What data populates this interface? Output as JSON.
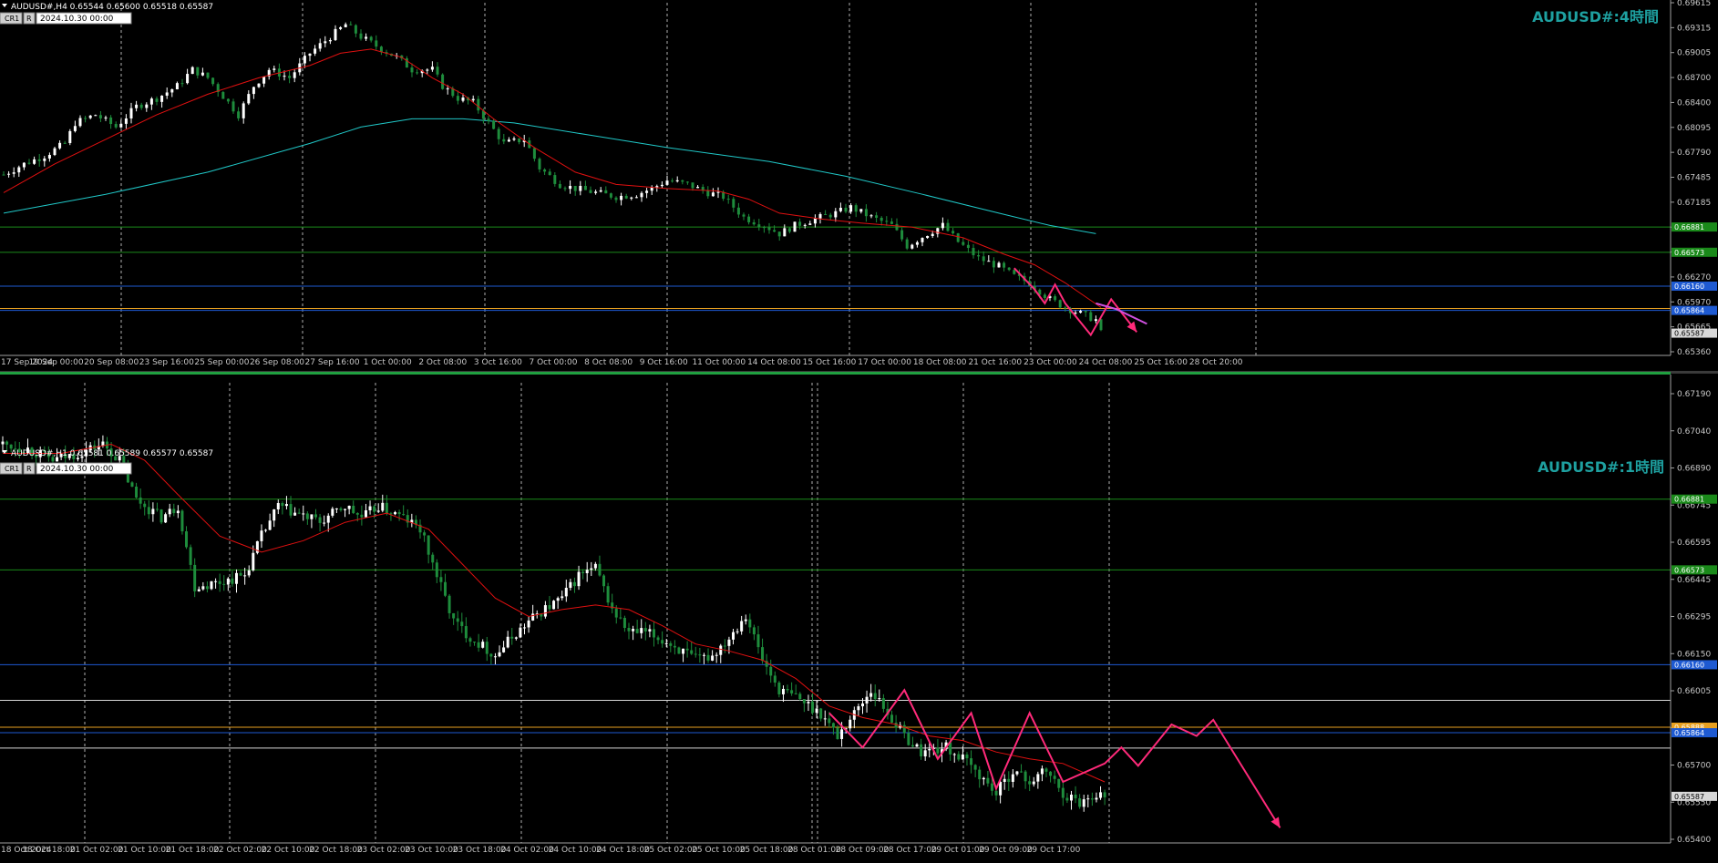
{
  "colors": {
    "background": "#000000",
    "bull_candle": "#ffffff",
    "bear_candle": "#1e8c3c",
    "ma_short": "#e01010",
    "ma_long": "#20c8c8",
    "level_green": "#1a8a1a",
    "level_blue": "#1e5ad2",
    "level_orange": "#e8a020",
    "level_white": "#d8d8d8",
    "projection_pink": "#ff2a7a",
    "projection_violet": "#d050e0",
    "title": "#1ea0a0"
  },
  "top_pane": {
    "symbol_info": "AUDUSD#,H4  0.65544 0.65600 0.65518 0.65587",
    "btn_cr1": "CR1",
    "btn_r": "R",
    "date_box": "2024.10.30 00:00",
    "title": "AUDUSD#:4時間",
    "price_badges": [
      {
        "text": "0.66881",
        "color": "#1a8a1a",
        "price": 0.66881
      },
      {
        "text": "0.66573",
        "color": "#1a8a1a",
        "price": 0.66573
      },
      {
        "text": "0.66160",
        "color": "#1e5ad2",
        "price": 0.6616
      },
      {
        "text": "0.65864",
        "color": "#1e5ad2",
        "price": 0.65864
      },
      {
        "text": "0.65587",
        "color": "#d8d8d8",
        "price": 0.65587
      }
    ]
  },
  "bottom_pane": {
    "symbol_info": "AUDUSD#,H1  0.65581 0.65589 0.65577 0.65587",
    "btn_cr1": "CR1",
    "btn_r": "R",
    "date_box": "2024.10.30 00:00",
    "title": "AUDUSD#:1時間",
    "price_badges": [
      {
        "text": "0.66881",
        "color": "#1a8a1a",
        "price": 0.66881
      },
      {
        "text": "0.66573",
        "color": "#1a8a1a",
        "price": 0.66573
      },
      {
        "text": "0.66160",
        "color": "#1e5ad2",
        "price": 0.6616
      },
      {
        "text": "0.65888",
        "color": "#e8a020",
        "price": 0.65888
      },
      {
        "text": "0.65864",
        "color": "#1e5ad2",
        "price": 0.65864
      },
      {
        "text": "0.65587",
        "color": "#d8d8d8",
        "price": 0.65587
      }
    ]
  },
  "chart_data": [
    {
      "type": "candlestick",
      "title": "AUDUSD#:4時間",
      "symbol": "AUDUSD#,H4",
      "ylim": [
        0.6536,
        0.69615
      ],
      "y_ticks": [
        "0.69615",
        "0.69315",
        "0.69005",
        "0.68700",
        "0.68400",
        "0.68095",
        "0.67790",
        "0.67485",
        "0.67185",
        "0.66880",
        "0.66575",
        "0.66270",
        "0.65970",
        "0.65665",
        "0.65360"
      ],
      "x_ticks": [
        "17 Sep 2024",
        "19 Sep 00:00",
        "20 Sep 08:00",
        "23 Sep 16:00",
        "25 Sep 00:00",
        "26 Sep 08:00",
        "27 Sep 16:00",
        "1 Oct 00:00",
        "2 Oct 08:00",
        "3 Oct 16:00",
        "7 Oct 00:00",
        "8 Oct 08:00",
        "9 Oct 16:00",
        "11 Oct 00:00",
        "14 Oct 08:00",
        "15 Oct 16:00",
        "17 Oct 00:00",
        "18 Oct 08:00",
        "21 Oct 16:00",
        "23 Oct 00:00",
        "24 Oct 08:00",
        "25 Oct 16:00",
        "28 Oct 20:00"
      ],
      "close_path": [
        [
          0,
          0.6752
        ],
        [
          4,
          0.6765
        ],
        [
          8,
          0.6775
        ],
        [
          12,
          0.679
        ],
        [
          14,
          0.6815
        ],
        [
          18,
          0.6825
        ],
        [
          22,
          0.681
        ],
        [
          26,
          0.6835
        ],
        [
          30,
          0.6845
        ],
        [
          34,
          0.686
        ],
        [
          37,
          0.688
        ],
        [
          40,
          0.687
        ],
        [
          44,
          0.684
        ],
        [
          46,
          0.6825
        ],
        [
          49,
          0.686
        ],
        [
          52,
          0.688
        ],
        [
          56,
          0.687
        ],
        [
          60,
          0.69
        ],
        [
          64,
          0.692
        ],
        [
          67,
          0.6935
        ],
        [
          70,
          0.692
        ],
        [
          74,
          0.6905
        ],
        [
          77,
          0.6895
        ],
        [
          80,
          0.688
        ],
        [
          84,
          0.688
        ],
        [
          86,
          0.686
        ],
        [
          89,
          0.6845
        ],
        [
          92,
          0.684
        ],
        [
          95,
          0.6815
        ],
        [
          98,
          0.679
        ],
        [
          102,
          0.6795
        ],
        [
          105,
          0.676
        ],
        [
          109,
          0.674
        ],
        [
          112,
          0.6735
        ],
        [
          116,
          0.673
        ],
        [
          120,
          0.6725
        ],
        [
          124,
          0.6728
        ],
        [
          127,
          0.6735
        ],
        [
          130,
          0.6745
        ],
        [
          134,
          0.674
        ],
        [
          138,
          0.673
        ],
        [
          141,
          0.6725
        ],
        [
          145,
          0.67
        ],
        [
          149,
          0.669
        ],
        [
          152,
          0.668
        ],
        [
          155,
          0.669
        ],
        [
          159,
          0.6698
        ],
        [
          163,
          0.6705
        ],
        [
          166,
          0.6712
        ],
        [
          170,
          0.67
        ],
        [
          174,
          0.669
        ],
        [
          177,
          0.6665
        ],
        [
          181,
          0.668
        ],
        [
          184,
          0.669
        ],
        [
          187,
          0.667
        ],
        [
          191,
          0.665
        ],
        [
          195,
          0.664
        ],
        [
          198,
          0.6628
        ],
        [
          201,
          0.662
        ],
        [
          205,
          0.66
        ],
        [
          208,
          0.659
        ],
        [
          212,
          0.658
        ],
        [
          214,
          0.6575
        ],
        [
          215,
          0.65587
        ]
      ],
      "ma_short": [
        [
          0,
          0.673
        ],
        [
          10,
          0.6765
        ],
        [
          20,
          0.6795
        ],
        [
          30,
          0.6825
        ],
        [
          40,
          0.685
        ],
        [
          50,
          0.687
        ],
        [
          60,
          0.6885
        ],
        [
          66,
          0.69
        ],
        [
          72,
          0.6905
        ],
        [
          78,
          0.6895
        ],
        [
          84,
          0.687
        ],
        [
          90,
          0.685
        ],
        [
          96,
          0.682
        ],
        [
          104,
          0.6785
        ],
        [
          112,
          0.6755
        ],
        [
          120,
          0.674
        ],
        [
          130,
          0.6735
        ],
        [
          140,
          0.6732
        ],
        [
          146,
          0.6722
        ],
        [
          152,
          0.6705
        ],
        [
          160,
          0.6698
        ],
        [
          168,
          0.6693
        ],
        [
          178,
          0.6688
        ],
        [
          188,
          0.6675
        ],
        [
          196,
          0.6655
        ],
        [
          202,
          0.6642
        ],
        [
          208,
          0.662
        ],
        [
          215,
          0.659
        ]
      ],
      "ma_long": [
        [
          0,
          0.6705
        ],
        [
          20,
          0.6728
        ],
        [
          40,
          0.6755
        ],
        [
          60,
          0.679
        ],
        [
          70,
          0.681
        ],
        [
          80,
          0.682
        ],
        [
          90,
          0.682
        ],
        [
          100,
          0.6815
        ],
        [
          115,
          0.68
        ],
        [
          130,
          0.6785
        ],
        [
          150,
          0.6768
        ],
        [
          165,
          0.675
        ],
        [
          180,
          0.6728
        ],
        [
          195,
          0.6705
        ],
        [
          205,
          0.669
        ],
        [
          214,
          0.668
        ]
      ],
      "levels": [
        0.66881,
        0.66573,
        0.6616,
        0.65888,
        0.65864
      ],
      "projection": [
        [
          198,
          0.6638
        ],
        [
          202,
          0.6612
        ],
        [
          204,
          0.6595
        ],
        [
          206,
          0.6618
        ],
        [
          208,
          0.6595
        ],
        [
          213,
          0.65565
        ],
        [
          217,
          0.66
        ],
        [
          222,
          0.656
        ]
      ],
      "projection_ma": [
        [
          214,
          0.6595
        ],
        [
          218,
          0.6588
        ],
        [
          224,
          0.657
        ]
      ]
    },
    {
      "type": "candlestick",
      "title": "AUDUSD#:1時間",
      "symbol": "AUDUSD#,H1",
      "ylim": [
        0.654,
        0.6734
      ],
      "y_ticks": [
        "0.67190",
        "0.67040",
        "0.66890",
        "0.66745",
        "0.66595",
        "0.66445",
        "0.66295",
        "0.66150",
        "0.66005",
        "0.65855",
        "0.65700",
        "0.65550",
        "0.65400"
      ],
      "x_ticks": [
        "18 Oct 2024",
        "18 Oct 18:00",
        "21 Oct 02:00",
        "21 Oct 10:00",
        "21 Oct 18:00",
        "22 Oct 02:00",
        "22 Oct 10:00",
        "22 Oct 18:00",
        "23 Oct 02:00",
        "23 Oct 10:00",
        "23 Oct 18:00",
        "24 Oct 02:00",
        "24 Oct 10:00",
        "24 Oct 18:00",
        "25 Oct 02:00",
        "25 Oct 10:00",
        "25 Oct 18:00",
        "28 Oct 01:00",
        "28 Oct 09:00",
        "28 Oct 17:00",
        "29 Oct 01:00",
        "29 Oct 09:00",
        "29 Oct 17:00"
      ],
      "close_path": [
        [
          0,
          0.6712
        ],
        [
          6,
          0.671
        ],
        [
          12,
          0.6705
        ],
        [
          18,
          0.6708
        ],
        [
          24,
          0.6712
        ],
        [
          28,
          0.6705
        ],
        [
          32,
          0.6688
        ],
        [
          38,
          0.668
        ],
        [
          42,
          0.6685
        ],
        [
          46,
          0.665
        ],
        [
          52,
          0.6652
        ],
        [
          58,
          0.6655
        ],
        [
          62,
          0.6672
        ],
        [
          66,
          0.6685
        ],
        [
          70,
          0.6682
        ],
        [
          76,
          0.6678
        ],
        [
          82,
          0.6685
        ],
        [
          86,
          0.668
        ],
        [
          90,
          0.6685
        ],
        [
          96,
          0.668
        ],
        [
          100,
          0.6675
        ],
        [
          104,
          0.6655
        ],
        [
          108,
          0.6635
        ],
        [
          112,
          0.6628
        ],
        [
          118,
          0.662
        ],
        [
          122,
          0.6628
        ],
        [
          128,
          0.6638
        ],
        [
          134,
          0.6645
        ],
        [
          138,
          0.6655
        ],
        [
          142,
          0.6658
        ],
        [
          146,
          0.664
        ],
        [
          150,
          0.663
        ],
        [
          154,
          0.663
        ],
        [
          160,
          0.6625
        ],
        [
          166,
          0.6618
        ],
        [
          170,
          0.662
        ],
        [
          174,
          0.6628
        ],
        [
          178,
          0.6638
        ],
        [
          182,
          0.6618
        ],
        [
          186,
          0.6605
        ],
        [
          190,
          0.6602
        ],
        [
          196,
          0.6595
        ],
        [
          200,
          0.6585
        ],
        [
          204,
          0.6595
        ],
        [
          208,
          0.6605
        ],
        [
          212,
          0.6595
        ],
        [
          216,
          0.6585
        ],
        [
          220,
          0.6578
        ],
        [
          226,
          0.658
        ],
        [
          230,
          0.6575
        ],
        [
          234,
          0.6568
        ],
        [
          238,
          0.656
        ],
        [
          242,
          0.657
        ],
        [
          246,
          0.6565
        ],
        [
          250,
          0.657
        ],
        [
          254,
          0.656
        ],
        [
          258,
          0.6556
        ],
        [
          262,
          0.656
        ],
        [
          264,
          0.65587
        ]
      ],
      "ma_short": [
        [
          0,
          0.6708
        ],
        [
          14,
          0.6708
        ],
        [
          26,
          0.6712
        ],
        [
          34,
          0.6705
        ],
        [
          42,
          0.669
        ],
        [
          52,
          0.6672
        ],
        [
          62,
          0.6665
        ],
        [
          72,
          0.667
        ],
        [
          82,
          0.6678
        ],
        [
          92,
          0.6682
        ],
        [
          102,
          0.6675
        ],
        [
          110,
          0.666
        ],
        [
          118,
          0.6645
        ],
        [
          126,
          0.6637
        ],
        [
          134,
          0.664
        ],
        [
          142,
          0.6642
        ],
        [
          150,
          0.664
        ],
        [
          158,
          0.6633
        ],
        [
          166,
          0.6625
        ],
        [
          174,
          0.6622
        ],
        [
          182,
          0.6618
        ],
        [
          190,
          0.661
        ],
        [
          198,
          0.6598
        ],
        [
          206,
          0.6593
        ],
        [
          214,
          0.659
        ],
        [
          222,
          0.6585
        ],
        [
          230,
          0.6583
        ],
        [
          238,
          0.6578
        ],
        [
          246,
          0.6575
        ],
        [
          254,
          0.6573
        ],
        [
          264,
          0.6565
        ]
      ],
      "levels": [
        0.66881,
        0.66573,
        0.6616,
        0.66005,
        0.65888,
        0.65864,
        0.65797
      ],
      "projection": [
        [
          198,
          0.6595
        ],
        [
          206,
          0.658
        ],
        [
          216,
          0.6605
        ],
        [
          224,
          0.6575
        ],
        [
          232,
          0.6595
        ],
        [
          238,
          0.6562
        ],
        [
          246,
          0.6595
        ],
        [
          254,
          0.6565
        ],
        [
          264,
          0.6573
        ],
        [
          268,
          0.658
        ],
        [
          272,
          0.6572
        ],
        [
          280,
          0.659
        ],
        [
          286,
          0.6585
        ],
        [
          290,
          0.6592
        ],
        [
          306,
          0.6545
        ]
      ]
    }
  ]
}
